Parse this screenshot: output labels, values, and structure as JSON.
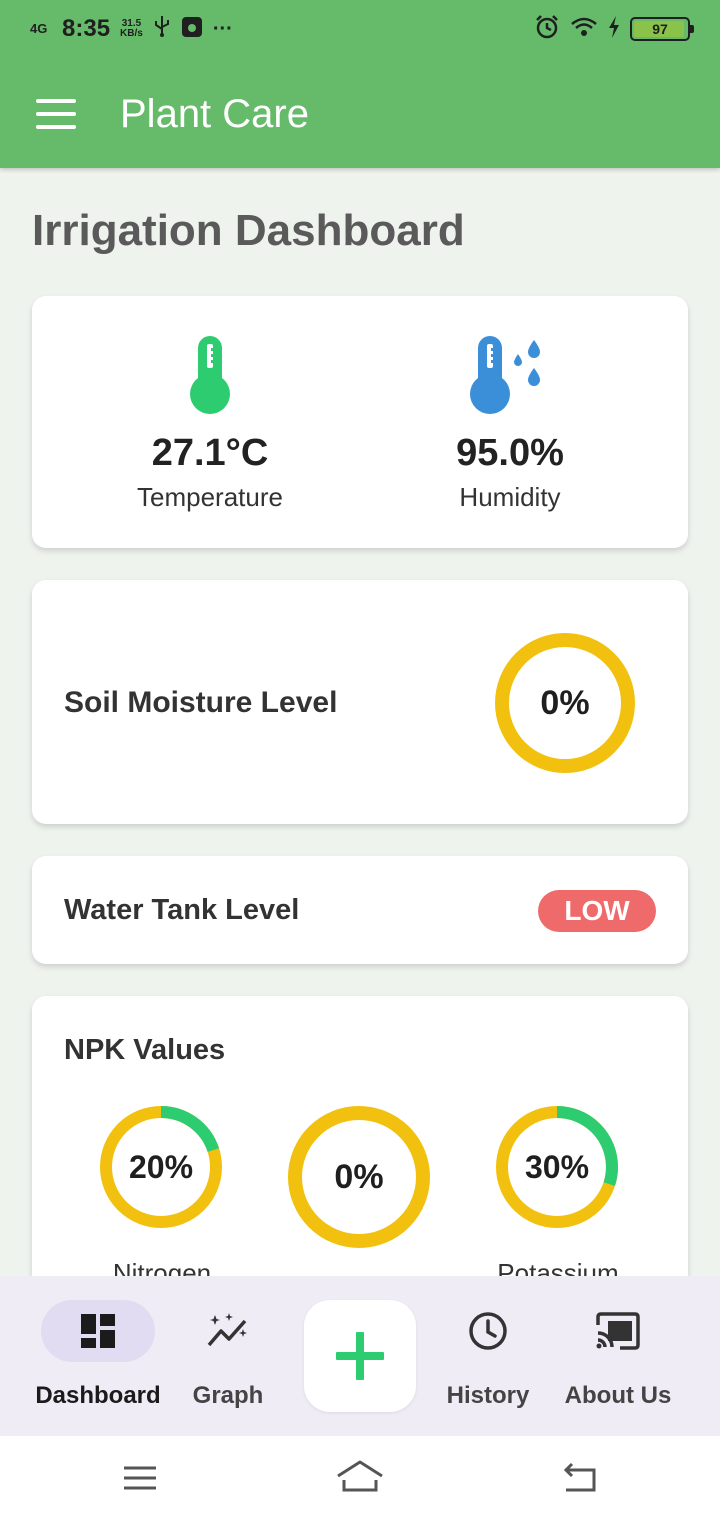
{
  "status_bar": {
    "network": "4G",
    "time": "8:35",
    "speed_value": "31.5",
    "speed_unit": "KB/s",
    "more": "···",
    "battery": "97"
  },
  "app_bar": {
    "title": "Plant Care"
  },
  "page": {
    "title": "Irrigation Dashboard"
  },
  "environment": {
    "temperature": {
      "value": "27.1°C",
      "label": "Temperature",
      "icon": "thermometer-icon",
      "color": "#2ecc71"
    },
    "humidity": {
      "value": "95.0%",
      "label": "Humidity",
      "icon": "thermometer-water-icon",
      "color": "#3b8fd9"
    }
  },
  "soil": {
    "label": "Soil Moisture Level",
    "value_text": "0%",
    "value": 0
  },
  "tank": {
    "label": "Water Tank Level",
    "status": "LOW",
    "status_color": "#ef6a6a"
  },
  "npk": {
    "title": "NPK Values",
    "items": [
      {
        "value_text": "20%",
        "value": 20,
        "label": "Nitrogen"
      },
      {
        "value_text": "0%",
        "value": 0,
        "label": ""
      },
      {
        "value_text": "30%",
        "value": 30,
        "label": "Potassium"
      }
    ]
  },
  "colors": {
    "primary": "#66bb6a",
    "gauge_track": "#f2c10f",
    "gauge_fill": "#2ecc71"
  },
  "bottom_nav": {
    "items": [
      {
        "label": "Dashboard",
        "icon": "dashboard-icon",
        "active": true
      },
      {
        "label": "Graph",
        "icon": "graph-icon",
        "active": false
      },
      {
        "label": "History",
        "icon": "history-icon",
        "active": false
      },
      {
        "label": "About Us",
        "icon": "cast-icon",
        "active": false
      }
    ],
    "fab_icon": "plus-icon"
  }
}
